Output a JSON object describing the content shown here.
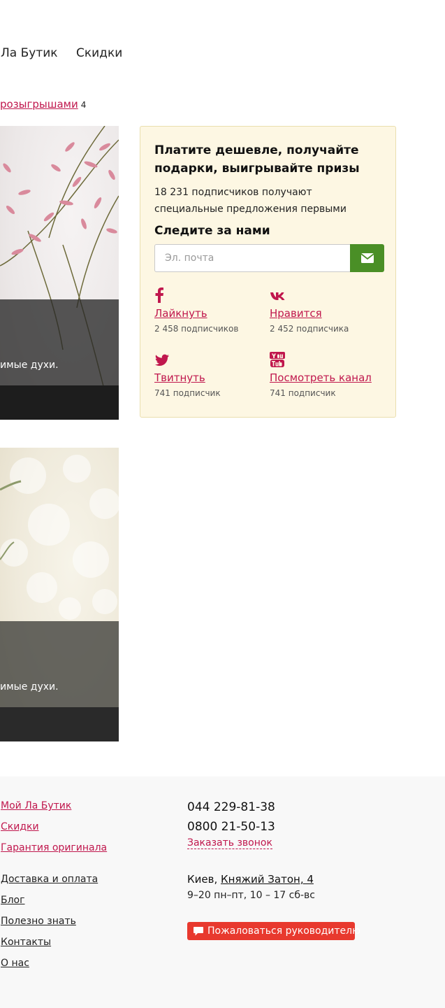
{
  "nav": {
    "items": [
      "Ла Бутик",
      "Скидки"
    ]
  },
  "promo": {
    "link": "розыгрышами",
    "count": "4"
  },
  "cards": [
    {
      "caption": "имые духи."
    },
    {
      "caption": "имые духи."
    }
  ],
  "subscribe": {
    "title": "Платите дешевле, получайте подарки, выигрывайте призы",
    "subtitle": "18 231 подписчиков получают специальные предложения первыми",
    "follow": "Следите за нами",
    "email_placeholder": "Эл. почта",
    "social": [
      {
        "icon": "facebook-icon",
        "label": "Лайкнуть",
        "count": "2 458 подписчиков"
      },
      {
        "icon": "vk-icon",
        "label": "Нравится",
        "count": "2 452 подписчика"
      },
      {
        "icon": "twitter-icon",
        "label": "Твитнуть",
        "count": "741 подписчик"
      },
      {
        "icon": "youtube-icon",
        "label": "Посмотреть канал",
        "count": "741 подписчик"
      }
    ]
  },
  "footer": {
    "links_primary": [
      "Мой Ла Бутик",
      "Скидки",
      "Гарантия оригинала"
    ],
    "links_secondary": [
      "Доставка и оплата",
      "Блог",
      "Полезно знать",
      "Контакты",
      "О нас"
    ],
    "phones": [
      "044 229-81-38",
      "0800 21-50-13"
    ],
    "callback": "Заказать звонок",
    "city": "Киев,",
    "street": "Княжий Затон, 4",
    "hours": "9–20 пн–пт, 10 – 17 сб-вс",
    "complain": "Пожаловаться руководителю"
  },
  "colors": {
    "accent": "#c0174d",
    "send_button": "#4a8f26",
    "complain_button": "#e8392e",
    "panel_bg": "#fdf7e3"
  }
}
